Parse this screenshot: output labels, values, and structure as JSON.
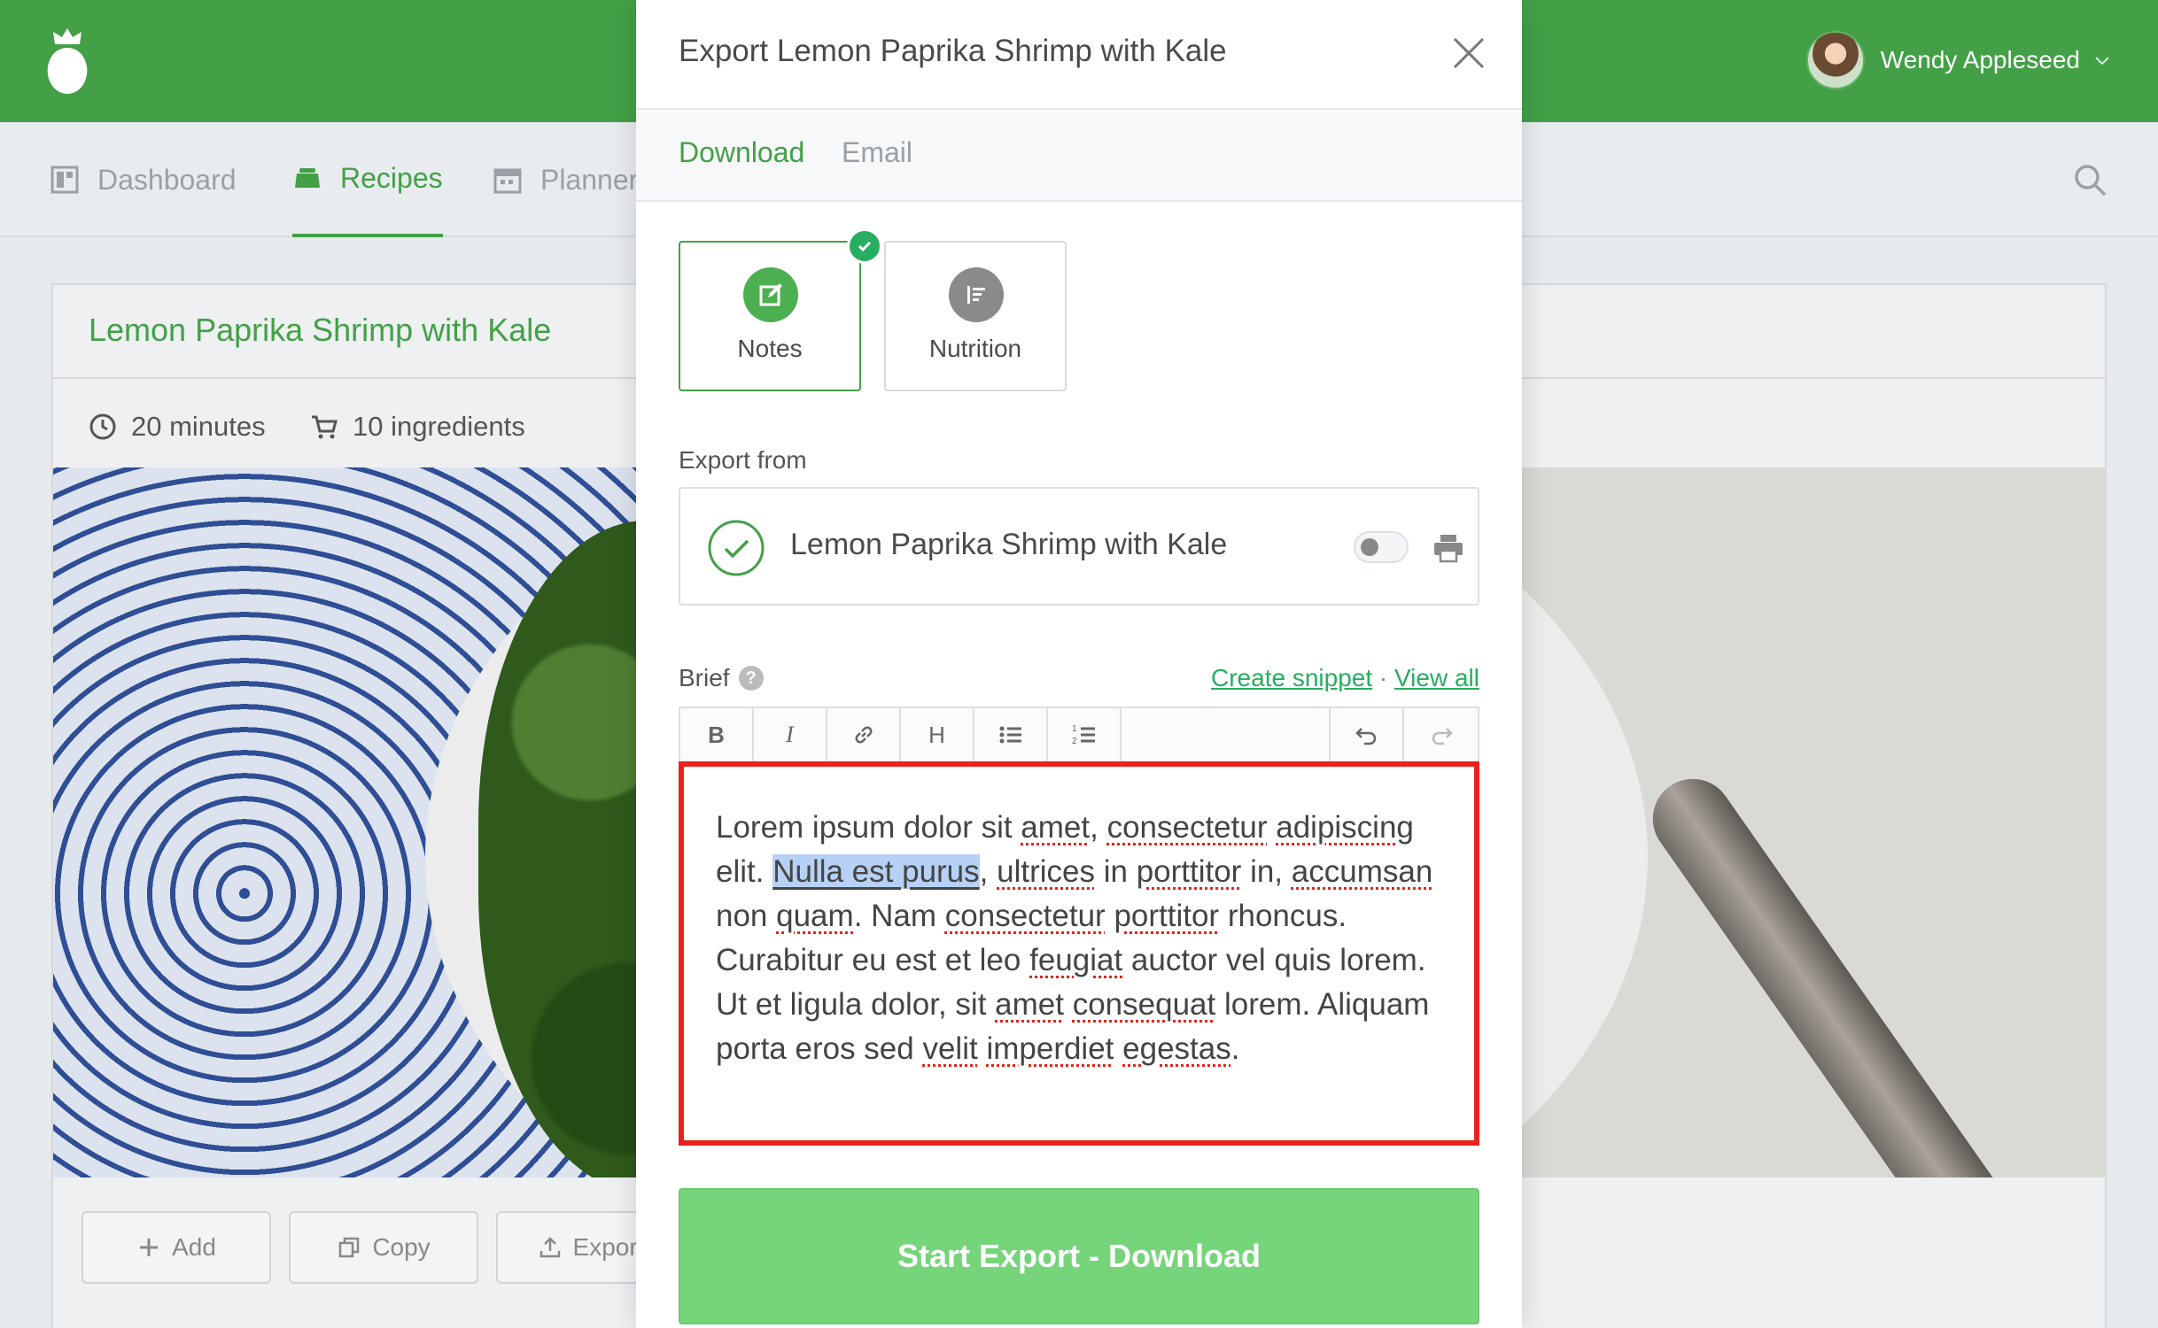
{
  "app": {
    "user_name": "Wendy Appleseed",
    "brand_color": "#43a047",
    "nav": [
      {
        "label": "Dashboard",
        "icon": "dashboard-icon"
      },
      {
        "label": "Recipes",
        "icon": "recipes-icon",
        "active": true
      },
      {
        "label": "Planner",
        "icon": "calendar-icon"
      }
    ]
  },
  "recipe": {
    "title": "Lemon Paprika Shrimp with Kale",
    "time": "20 minutes",
    "ingredients": "10 ingredients",
    "actions": [
      "Add",
      "Copy",
      "Export"
    ]
  },
  "modal": {
    "title": "Export Lemon Paprika Shrimp with Kale",
    "tabs": [
      "Download",
      "Email"
    ],
    "templates": [
      {
        "label": "Notes",
        "selected": true,
        "color": "#4caf50"
      },
      {
        "label": "Nutrition",
        "selected": false,
        "color": "#8a8a8a"
      }
    ],
    "export_from_label": "Export from",
    "export_item": "Lemon Paprika Shrimp with Kale",
    "brief_label": "Brief",
    "create_snippet": "Create snippet",
    "link_sep": "·",
    "view_all": "View all",
    "toolbar": [
      "B",
      "I",
      "link",
      "H",
      "bulleted-list",
      "numbered-list",
      "undo",
      "redo"
    ],
    "brief_text": {
      "s1": "Lorem ipsum dolor sit ",
      "w_amet": "amet",
      "s2": ", ",
      "w_consectetur": "consectetur",
      "s3": " ",
      "w_adipiscing": "adipiscing",
      "s4": " elit. ",
      "highlight": "Nulla est purus",
      "s5": ", ",
      "w_ultrices": "ultrices",
      "s6": " in ",
      "w_porttitor": "porttitor",
      "s7": " in, ",
      "w_accumsan": "accumsan",
      "s8": " non ",
      "w_quam": "quam",
      "s9": ". Nam ",
      "w_consectetur2": "consectetur",
      "s10": " ",
      "w_porttitor2": "porttitor",
      "s11": " rhoncus. Curabitur eu est et leo ",
      "w_feugiat": "feugiat",
      "s12": " auctor vel quis lorem. Ut et ligula dolor, sit ",
      "w_amet2": "amet",
      "s13": " ",
      "w_consequat": "consequat",
      "s14": " lorem. Aliquam porta eros sed ",
      "w_velit": "velit",
      "s15": " ",
      "w_imperdiet": "imperdiet",
      "s16": " ",
      "w_egestas": "egestas",
      "s17": "."
    },
    "submit": "Start Export - Download"
  }
}
